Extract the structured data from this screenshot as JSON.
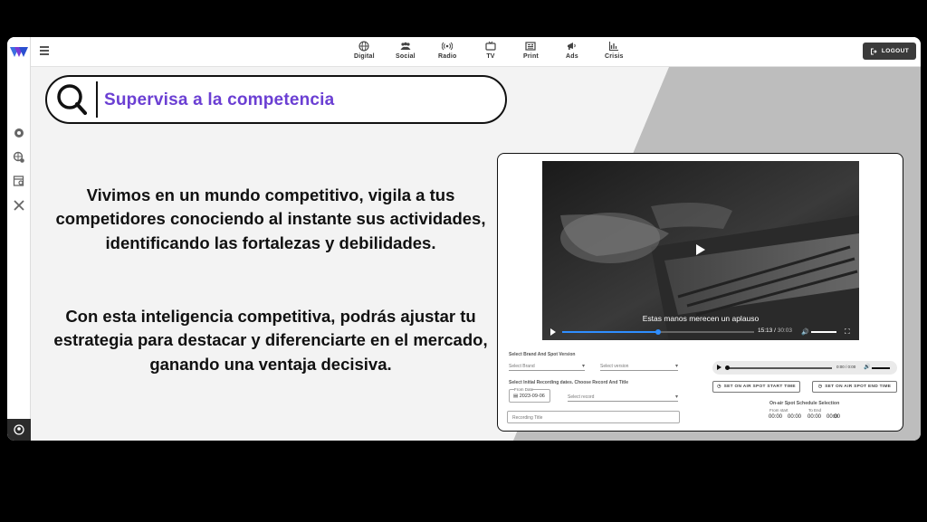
{
  "nav": {
    "items": [
      {
        "label": "Digital",
        "icon": "globe-icon"
      },
      {
        "label": "Social",
        "icon": "people-icon"
      },
      {
        "label": "Radio",
        "icon": "radio-icon"
      },
      {
        "label": "TV",
        "icon": "tv-icon"
      },
      {
        "label": "Print",
        "icon": "newspaper-icon"
      },
      {
        "label": "Ads",
        "icon": "megaphone-icon"
      },
      {
        "label": "Crisis",
        "icon": "chart-icon"
      }
    ],
    "logout_label": "LOGOUT"
  },
  "hero": {
    "title": "Supervisa a la competencia",
    "paragraph1": "Vivimos en un mundo competitivo, vigila a tus competidores conociendo al instante sus actividades, identificando las fortalezas y debilidades.",
    "paragraph2": "Con esta inteligencia competitiva, podrás ajustar tu estrategia para destacar y diferenciarte en el mercado, ganando una ventaja decisiva."
  },
  "player": {
    "caption": "Estas manos merecen un aplauso",
    "time_current": "15:13",
    "time_total": "30:03",
    "progress": 0.5
  },
  "form": {
    "brand_section_label": "Select Brand And Spot Version",
    "brand_placeholder": "Select Brand",
    "version_placeholder": "Select version",
    "recording_section_label": "Select Initial Recording dates. Choose Record And Title",
    "from_date_label": "From Date",
    "from_date_value": "2023-09-06",
    "record_placeholder": "Select record",
    "title_placeholder": "Recording Title",
    "audio_time": "0:00 / 0:00",
    "set_start_label": "SET ON AIR SPOT START TIME",
    "set_end_label": "SET ON AIR SPOT END TIME",
    "schedule_label": "On-air Spot Schedule Selection",
    "from_start_label": "From start",
    "to_end_label": "To End",
    "from_start_value": "00:00",
    "from_start_value2": "00:00",
    "to_end_value": "00:00",
    "to_end_value2": "00:00"
  },
  "colors": {
    "accent": "#6b3fd3",
    "progress": "#2f8eff",
    "logout_bg": "#3b3b3b"
  }
}
